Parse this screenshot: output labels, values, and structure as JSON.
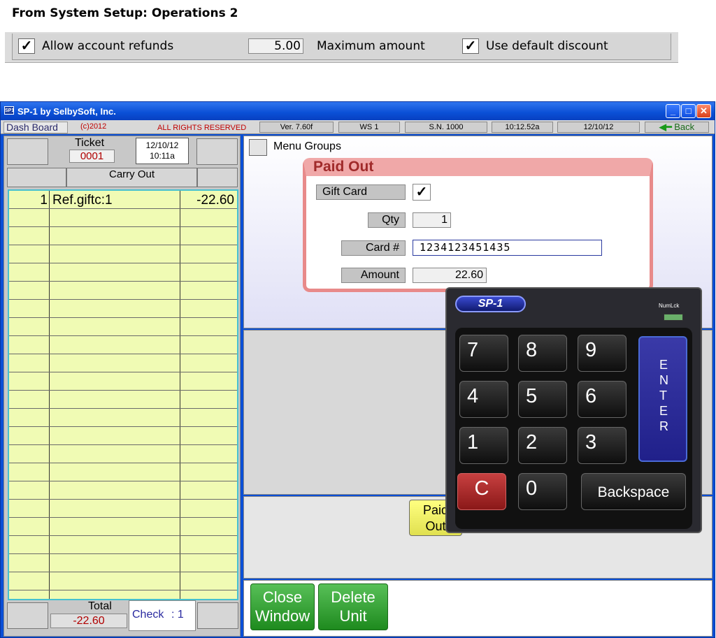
{
  "caption": "From System Setup:  Operations 2",
  "setup": {
    "allow_refunds_check": "✓",
    "allow_refunds_label": "Allow account refunds",
    "max_amount_value": "5.00",
    "max_amount_label": "Maximum amount",
    "default_discount_check": "✓",
    "default_discount_label": "Use default discount"
  },
  "window": {
    "title": "SP-1 by SelbySoft, Inc.",
    "app_icon": "SP1",
    "minimize": "_",
    "maximize": "□",
    "close": "✕"
  },
  "infobar": {
    "dashboard": "Dash Board",
    "copyright": "(c)2012",
    "rights": "ALL RIGHTS RESERVED",
    "version": "Ver. 7.60f",
    "ws": "WS  1",
    "sn": "S.N. 1000",
    "time": "10:12.52a",
    "date": "12/10/12",
    "back": "Back"
  },
  "ticket": {
    "label": "Ticket",
    "number": "0001",
    "date": "12/10/12",
    "time": "10:11a",
    "order_type": "Carry Out",
    "items": [
      {
        "qty": "1",
        "name": "Ref.giftc:1",
        "amount": "-22.60"
      }
    ],
    "total_label": "Total",
    "total_value": "-22.60",
    "check_label": "Check",
    "check_value": ":  1"
  },
  "menu_groups_label": "Menu Groups",
  "paid_out": {
    "title": "Paid Out",
    "gift_card_label": "Gift Card",
    "gift_card_check": "✓",
    "qty_label": "Qty",
    "qty_value": "1",
    "card_label": "Card #",
    "card_value": "1234123451435",
    "amount_label": "Amount",
    "amount_value": "22.60"
  },
  "paid_out_button": [
    "Paid",
    "Out"
  ],
  "keypad": {
    "badge": "SP-1",
    "numlock": "NumLck",
    "keys": [
      "7",
      "8",
      "9",
      "4",
      "5",
      "6",
      "1",
      "2",
      "3"
    ],
    "zero": "0",
    "clear": "C",
    "backspace": "Backspace",
    "enter": "ENTER"
  },
  "bottom_buttons": {
    "close_window": [
      "Close",
      "Window"
    ],
    "delete_unit": [
      "Delete",
      "Unit"
    ]
  }
}
